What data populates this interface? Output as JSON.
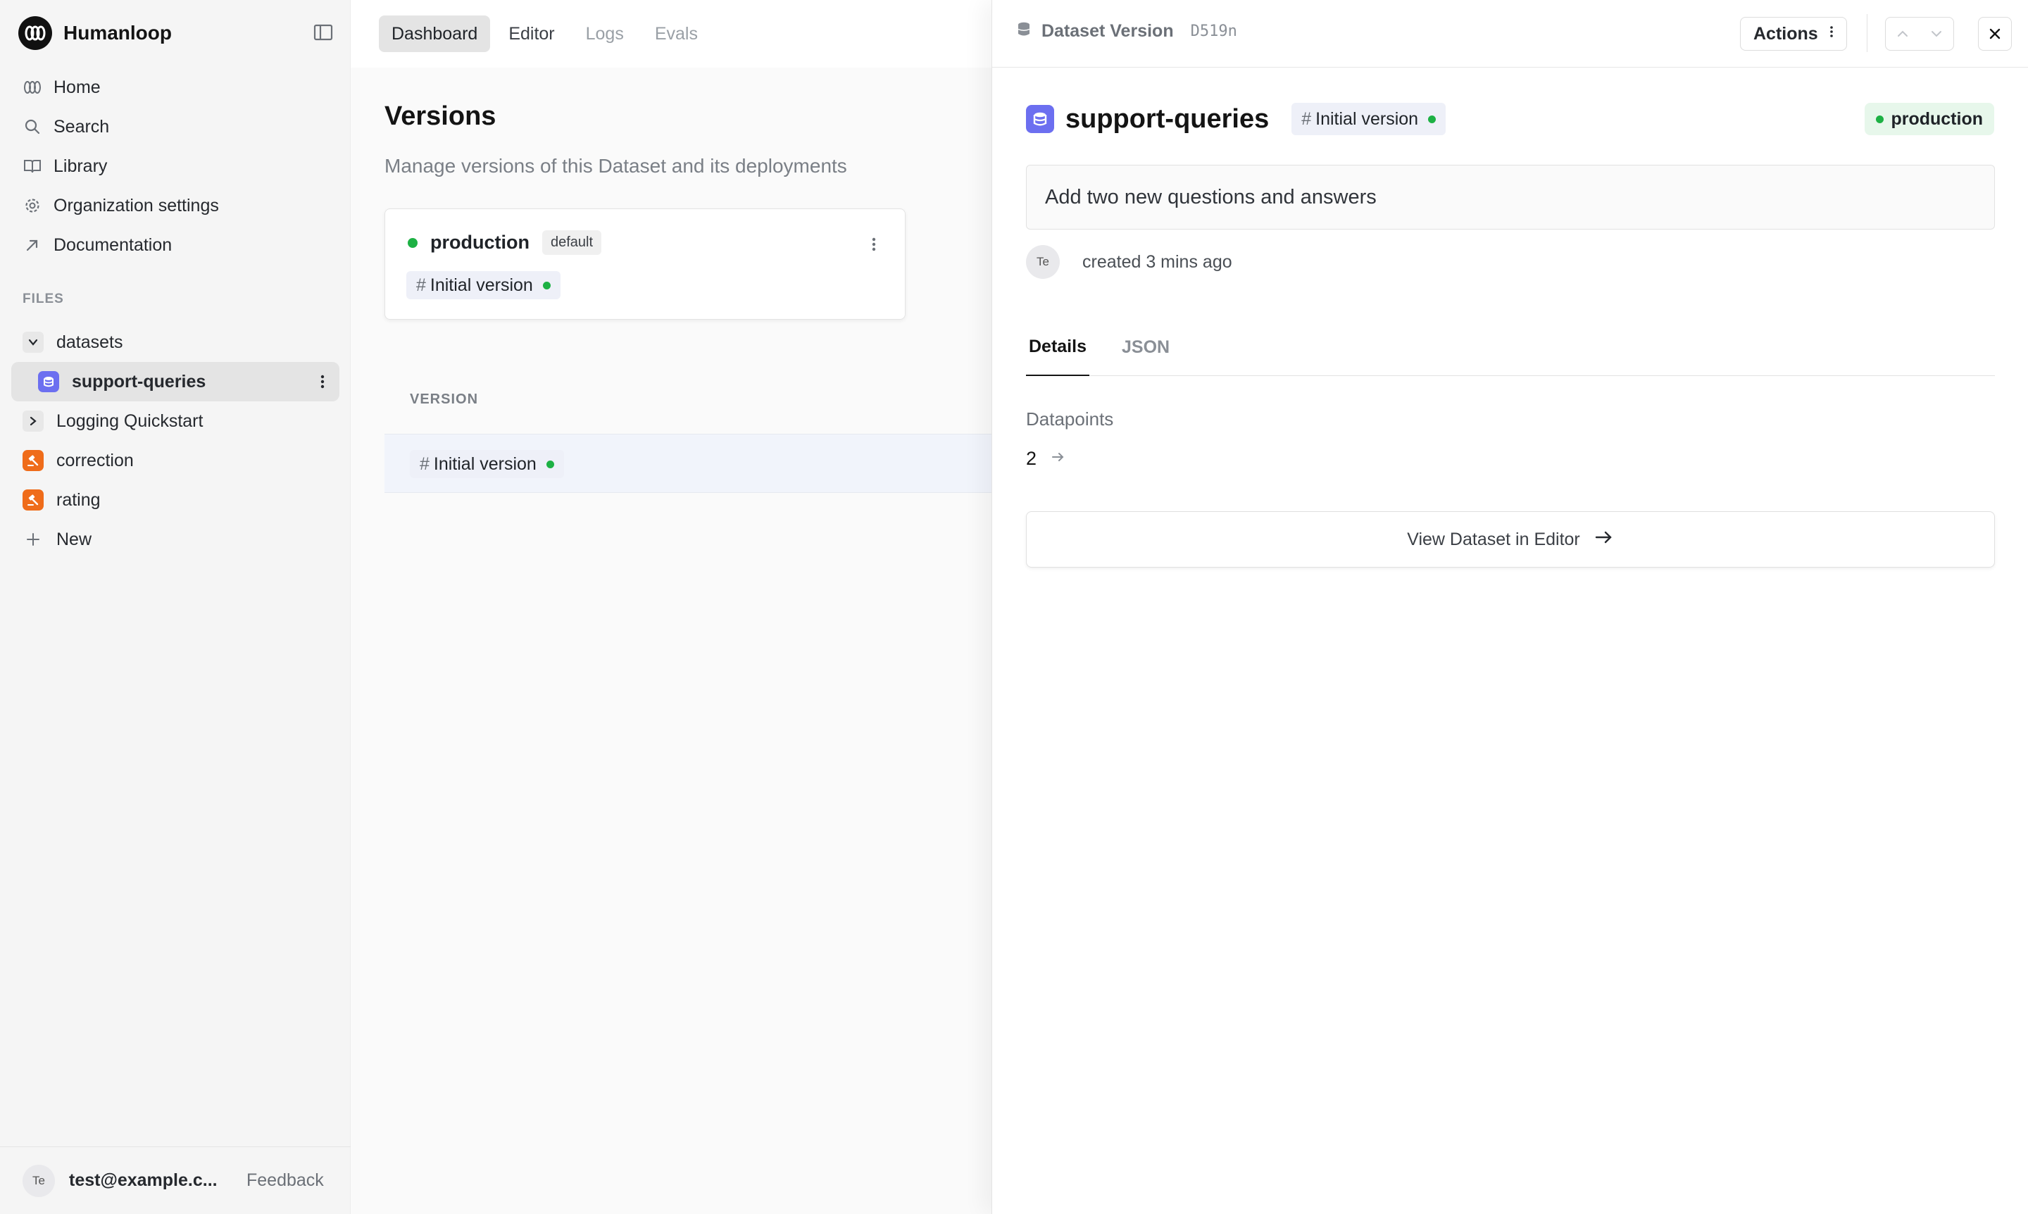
{
  "sidebar": {
    "brand_name": "Humanloop",
    "nav": [
      {
        "label": "Home",
        "icon": "home-icon"
      },
      {
        "label": "Search",
        "icon": "search-icon"
      },
      {
        "label": "Library",
        "icon": "book-icon"
      },
      {
        "label": "Organization settings",
        "icon": "gear-icon"
      },
      {
        "label": "Documentation",
        "icon": "external-link-icon"
      }
    ],
    "files_label": "FILES",
    "tree": [
      {
        "label": "datasets",
        "icon": "chevron-down-icon"
      },
      {
        "label": "support-queries",
        "icon": "dataset-icon"
      },
      {
        "label": "Logging Quickstart",
        "icon": "chevron-right-icon"
      },
      {
        "label": "correction",
        "icon": "evaluator-icon"
      },
      {
        "label": "rating",
        "icon": "evaluator-icon"
      },
      {
        "label": "New",
        "icon": "plus-icon"
      }
    ],
    "footer": {
      "avatar_initials": "Te",
      "email": "test@example.c...",
      "feedback": "Feedback"
    }
  },
  "top_tabs": [
    "Dashboard",
    "Editor",
    "Logs",
    "Evals"
  ],
  "main": {
    "title": "Versions",
    "subtitle": "Manage versions of this Dataset and its deployments",
    "deployment": {
      "env": "production",
      "badge": "default",
      "version": "Initial version"
    },
    "table": {
      "column_header": "VERSION",
      "rows": [
        {
          "version": "Initial version"
        }
      ]
    }
  },
  "drawer": {
    "header_title": "Dataset Version",
    "version_id": "D519n",
    "actions_label": "Actions",
    "title": "support-queries",
    "version_chip": "Initial version",
    "environment_badge": "production",
    "commit_message": "Add two new questions and answers",
    "author_initials": "Te",
    "created_text": "created 3 mins ago",
    "tabs": [
      "Details",
      "JSON"
    ],
    "datapoints_label": "Datapoints",
    "datapoints_value": "2",
    "view_button": "View Dataset in Editor"
  },
  "colors": {
    "accent_dataset": "#6c6ff0",
    "accent_evaluator": "#ef6c1a",
    "status_green": "#1db144"
  }
}
